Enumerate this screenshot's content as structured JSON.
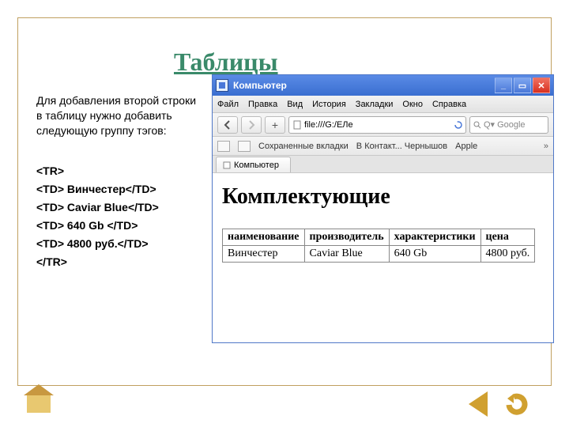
{
  "slide": {
    "title": "Таблицы",
    "intro": "Для добавления второй строки в таблицу нужно добавить следующую группу тэгов:",
    "code": {
      "l1": "<TR>",
      "l2": "<TD> Винчестер</TD>",
      "l3": "<TD> Caviar Blue</TD>",
      "l4": "<TD> 640 Gb </TD>",
      "l5": "<TD> 4800 руб.</TD>",
      "l6": "</TR>"
    }
  },
  "browser": {
    "window_title": "Компьютер",
    "menus": [
      "Файл",
      "Правка",
      "Вид",
      "История",
      "Закладки",
      "Окно",
      "Справка"
    ],
    "url": "file:///G:/ЕЛе",
    "search_placeholder": "Google",
    "bookmarks_label": "Сохраненные вкладки",
    "bookmark_items": [
      "В Контакт... Чернышов",
      "Apple"
    ],
    "tab_label": "Компьютер"
  },
  "page": {
    "heading": "Комплектующие",
    "headers": [
      "наименование",
      "производитель",
      "характеристики",
      "цена"
    ],
    "row": [
      "Винчестер",
      "Caviar Blue",
      "640 Gb",
      "4800 руб."
    ]
  }
}
